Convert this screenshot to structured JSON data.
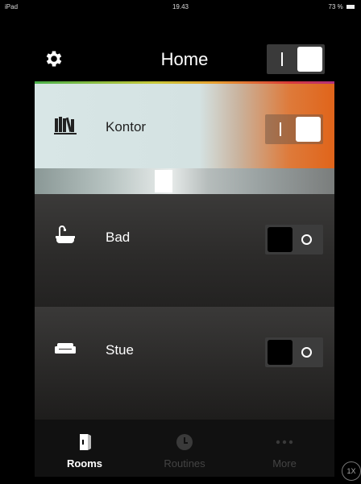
{
  "statusbar": {
    "device": "iPad",
    "time": "19.43",
    "battery": "73 %"
  },
  "header": {
    "title": "Home",
    "toggle_state": "on"
  },
  "rooms": [
    {
      "name": "Kontor",
      "icon": "books-icon",
      "state": "on",
      "brightness_fraction": 0.43
    },
    {
      "name": "Bad",
      "icon": "bathtub-icon",
      "state": "off"
    },
    {
      "name": "Stue",
      "icon": "sofa-icon",
      "state": "off"
    }
  ],
  "tabs": [
    {
      "label": "Rooms",
      "icon": "door-icon",
      "active": true
    },
    {
      "label": "Routines",
      "icon": "clock-icon",
      "active": false
    },
    {
      "label": "More",
      "icon": "more-dots-icon",
      "active": false
    }
  ],
  "zoom": "1X"
}
